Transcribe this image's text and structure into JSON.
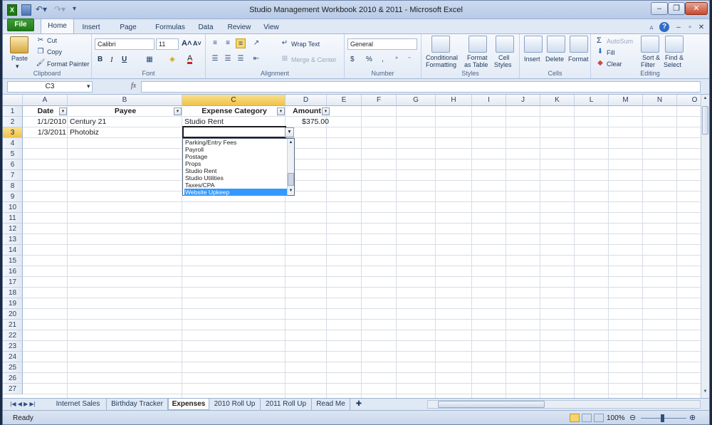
{
  "window": {
    "title": "Studio Management Workbook 2010 & 2011  -  Microsoft Excel"
  },
  "ribbon_tabs": [
    "File",
    "Home",
    "Insert",
    "Page Layout",
    "Formulas",
    "Data",
    "Review",
    "View"
  ],
  "ribbon": {
    "clipboard": {
      "paste": "Paste",
      "cut": "Cut",
      "copy": "Copy",
      "format_painter": "Format Painter",
      "label": "Clipboard"
    },
    "font": {
      "name": "Calibri",
      "size": "11",
      "bold": "B",
      "italic": "I",
      "underline": "U",
      "label": "Font"
    },
    "alignment": {
      "wrap_text": "Wrap Text",
      "merge_center": "Merge & Center",
      "label": "Alignment"
    },
    "number": {
      "format": "General",
      "currency": "$",
      "percent": "%",
      "comma": ",",
      "label": "Number"
    },
    "styles": {
      "conditional": [
        "Conditional",
        "Formatting"
      ],
      "format_table": [
        "Format",
        "as Table"
      ],
      "cell_styles": [
        "Cell",
        "Styles"
      ],
      "label": "Styles"
    },
    "cells": {
      "insert": "Insert",
      "delete": "Delete",
      "format": "Format",
      "label": "Cells"
    },
    "editing": {
      "autosum": "AutoSum",
      "fill": "Fill",
      "clear": "Clear",
      "sort_filter": [
        "Sort &",
        "Filter"
      ],
      "find_select": [
        "Find &",
        "Select"
      ],
      "label": "Editing"
    }
  },
  "formula_bar": {
    "name_box": "C3",
    "fx": "fx",
    "value": ""
  },
  "columns": [
    "A",
    "B",
    "C",
    "D",
    "E",
    "F",
    "G",
    "H",
    "I",
    "J",
    "K",
    "L",
    "M",
    "N",
    "O"
  ],
  "selected_column": "C",
  "rows": [
    "1",
    "2",
    "3",
    "4",
    "5",
    "6",
    "7",
    "8",
    "9",
    "10",
    "11",
    "12",
    "13",
    "14",
    "15",
    "16",
    "17",
    "18",
    "19",
    "20",
    "21",
    "22",
    "23",
    "24",
    "25",
    "26",
    "27"
  ],
  "selected_row": "3",
  "table": {
    "headers": [
      "Date",
      "Payee",
      "Expense Category",
      "Amount"
    ],
    "rows": [
      {
        "date": "1/1/2010",
        "payee": "Century 21",
        "category": "Studio Rent",
        "amount": "$375.00"
      },
      {
        "date": "1/3/2011",
        "payee": "Photobiz",
        "category": "",
        "amount": ""
      }
    ]
  },
  "dropdown": {
    "items": [
      "Parking/Entry Fees",
      "Payroll",
      "Postage",
      "Props",
      "Studio Rent",
      "Studio Utilities",
      "Taxes/CPA",
      "Website Upkeep"
    ],
    "highlighted": "Website Upkeep"
  },
  "sheet_tabs": [
    "Internet Sales",
    "Birthday Tracker",
    "Expenses",
    "2010 Roll Up",
    "2011 Roll Up",
    "Read Me"
  ],
  "active_sheet": "Expenses",
  "status": {
    "text": "Ready",
    "zoom": "100%"
  }
}
